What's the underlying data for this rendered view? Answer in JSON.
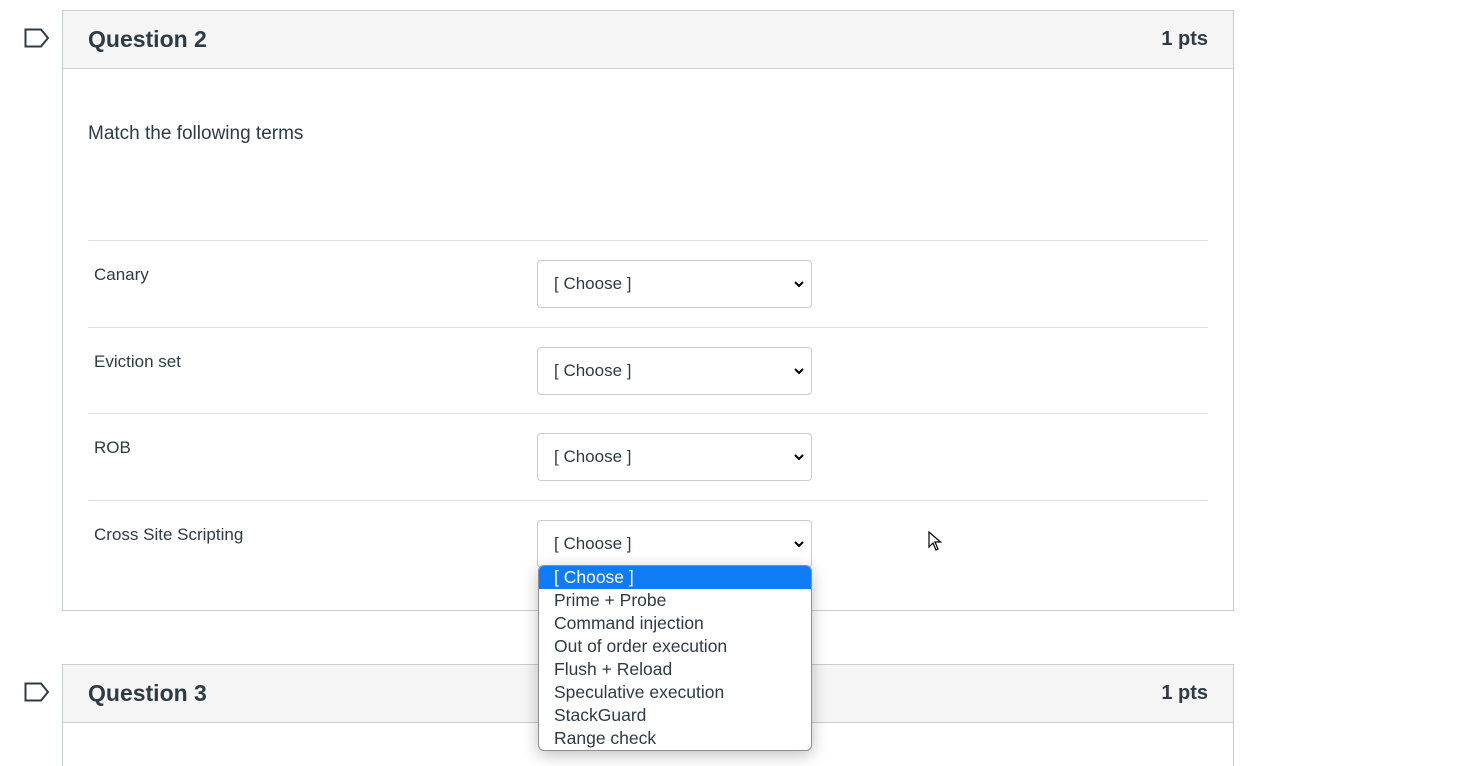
{
  "questions": [
    {
      "title": "Question 2",
      "points": "1 pts",
      "prompt": "Match the following terms",
      "rows": [
        {
          "term": "Canary",
          "selected": "[ Choose ]"
        },
        {
          "term": "Eviction set",
          "selected": "[ Choose ]"
        },
        {
          "term": "ROB",
          "selected": "[ Choose ]"
        },
        {
          "term": "Cross Site Scripting",
          "selected": "[ Choose ]"
        }
      ]
    },
    {
      "title": "Question 3",
      "points": "1 pts"
    }
  ],
  "dropdown": {
    "options": [
      "[ Choose ]",
      "Prime + Probe",
      "Command injection",
      "Out of order execution",
      "Flush + Reload",
      "Speculative execution",
      "StackGuard",
      "Range check"
    ],
    "highlighted_option": "[ Choose ]"
  },
  "colors": {
    "header_bg": "#f5f5f5",
    "border": "#c7cdd1",
    "text": "#2d3b45",
    "highlight": "#0f7bf5"
  }
}
